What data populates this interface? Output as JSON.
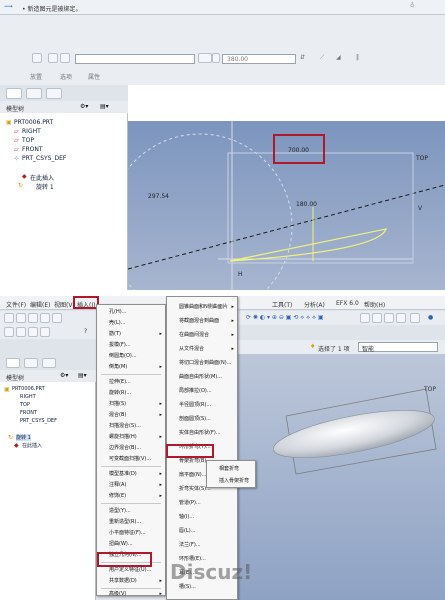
{
  "top": {
    "status_message": "• 新造图元是被绑定。",
    "dim_field_value": "380.00",
    "dashboard_tabs": [
      "放置",
      "选项",
      "属性"
    ],
    "tree_title": "模型树",
    "tree_items": [
      "PRT0006.PRT",
      "RIGHT",
      "TOP",
      "FRONT",
      "PRT_CSYS_DEF",
      "在此插入",
      "旋转 1"
    ],
    "dim_selected": "700.00",
    "dim_left": "297.54",
    "dim_inner": "180.00",
    "dim_v": "V",
    "dim_top": "TOP",
    "dim_h": "H"
  },
  "bottom": {
    "menubar": [
      "文件(F)",
      "编辑(E)",
      "视图(V)",
      "插入(I)"
    ],
    "menubar_right": [
      "工具(T)",
      "分析(A)",
      "EFX 6.0",
      "帮助(H)"
    ],
    "tree_title": "模型树",
    "tree_items": [
      "PRT0006.PRT",
      "RIGHT",
      "TOP",
      "FRONT",
      "PRT_CSYS_DEF",
      "旋转 1",
      "在此插入"
    ],
    "selection_status": "选择了 1 项",
    "filter_value": "智能",
    "top_label": "TOP",
    "insert_menu": [
      {
        "label": "孔(H)...",
        "sub": false
      },
      {
        "label": "壳(L)...",
        "sub": false
      },
      {
        "label": "筋(T)",
        "sub": true
      },
      {
        "label": "拔模(F)...",
        "sub": false
      },
      {
        "label": "倒圆角(O)...",
        "sub": false
      },
      {
        "label": "倒角(M)",
        "sub": true
      },
      {
        "label": "拉伸(E)...",
        "sub": false
      },
      {
        "label": "旋转(R)...",
        "sub": false
      },
      {
        "label": "扫描(S)",
        "sub": true
      },
      {
        "label": "混合(B)",
        "sub": true
      },
      {
        "label": "扫描混合(S)...",
        "sub": false
      },
      {
        "label": "螺旋扫描(H)",
        "sub": true
      },
      {
        "label": "边界混合(B)...",
        "sub": false
      },
      {
        "label": "可变截面扫描(V)...",
        "sub": false
      },
      {
        "label": "模型基准(D)",
        "sub": true
      },
      {
        "label": "注释(A)",
        "sub": true
      },
      {
        "label": "修饰(E)",
        "sub": true
      },
      {
        "label": "造型(Y)...",
        "sub": false
      },
      {
        "label": "重新造型(R)...",
        "sub": false
      },
      {
        "label": "小平面特征(F)...",
        "sub": false
      },
      {
        "label": "扭曲(W)...",
        "sub": false
      },
      {
        "label": "独立几何(N)...",
        "sub": false
      },
      {
        "label": "用户定义特征(U)...",
        "sub": false
      },
      {
        "label": "共享数据(D)",
        "sub": true
      },
      {
        "label": "高级(V)",
        "sub": true
      }
    ],
    "advanced_menu": [
      "圆锥曲面和N侧曲面片",
      "将截面混合到曲面",
      "在曲面间混合",
      "从文件混合",
      "将切口混合到曲面(N)...",
      "曲面自由形状(M)...",
      "局部推拉(O)...",
      "半径圆顶(R)...",
      "剖面圆顶(S)...",
      "实体自由形状(F)...",
      "环形折弯(T)...",
      "骨架折弯(B)...",
      "扇平面(N)...",
      "折弯实体(S)...",
      "管道(P)...",
      "轴(I)...",
      "唇(L)...",
      "法兰(F)...",
      "环形槽(E)...",
      "耳(E)...",
      "槽(S)..."
    ],
    "bend_submenu": [
      "相套折弯",
      "插入骨架折弯"
    ],
    "watermark": "Discuz!"
  }
}
